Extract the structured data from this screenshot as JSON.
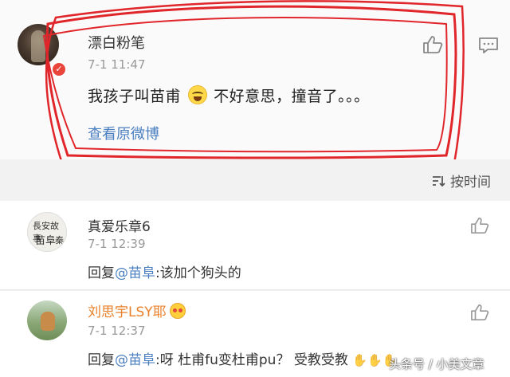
{
  "post": {
    "author": "漂白粉笔",
    "time": "7-1 11:47",
    "content_before": "我孩子叫苗甫",
    "content_after": "不好意思，撞音了。。。",
    "view_original": "查看原微博",
    "verified_badge": "✓"
  },
  "sort": {
    "label": "按时间",
    "icon": "sort-icon"
  },
  "comments": [
    {
      "name": "真爱乐章6",
      "time": "7-1 12:39",
      "reply_prefix": "回复",
      "mention": "@苗阜",
      "text": ":该加个狗头的",
      "avatar_text": [
        "長安故事",
        "苗阜",
        "秦"
      ]
    },
    {
      "name": "刘思宇LSY耶",
      "time": "7-1 12:37",
      "reply_prefix": "回复",
      "mention": "@苗阜",
      "text": ":呀 杜甫fu变杜甫pu？ 受教受教"
    }
  ],
  "watermark": "头条号 / 小美文章",
  "colors": {
    "accent_link": "#4a7fc1",
    "highlight_name": "#e8802a",
    "scribble": "#e0262a"
  }
}
